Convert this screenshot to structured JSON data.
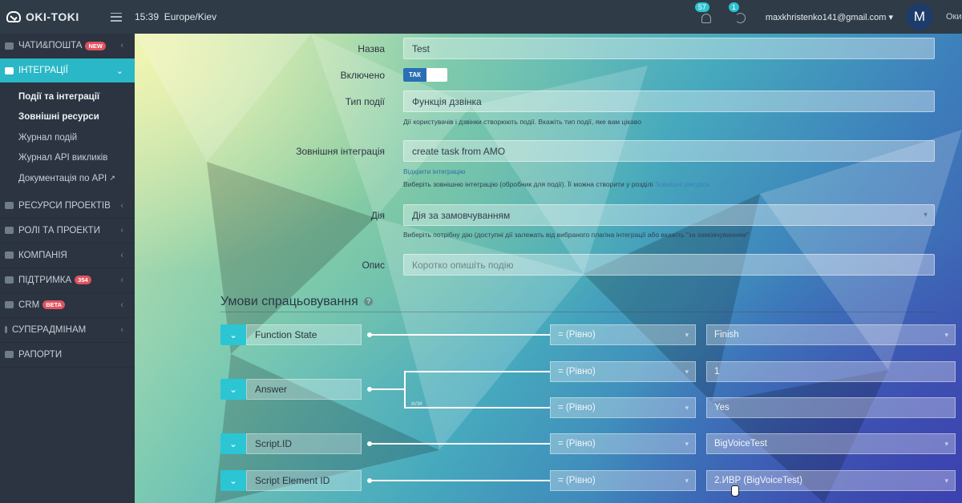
{
  "topbar": {
    "logo_text": "OKI-TOKI",
    "time": "15:39",
    "timezone": "Europe/Kiev",
    "notifications_count": "57",
    "sync_count": "1",
    "email": "maxkhristenko141@gmail.com",
    "avatar_letter": "M",
    "user_trunc": "Оки-"
  },
  "sidebar": {
    "items": [
      {
        "label": "ЧАТИ&ПОШТА",
        "badge": "NEW"
      },
      {
        "label": "ІНТЕГРАЦІЇ"
      },
      {
        "label": "РЕСУРСИ ПРОЕКТІВ"
      },
      {
        "label": "РОЛІ ТА ПРОЕКТИ"
      },
      {
        "label": "КОМПАНІЯ"
      },
      {
        "label": "ПІДТРИМКА",
        "badge": "354"
      },
      {
        "label": "CRM",
        "badge": "BETA"
      },
      {
        "label": "СУПЕРАДМІНАМ"
      },
      {
        "label": "РАПОРТИ"
      }
    ],
    "subitems": [
      "Події та інтеграції",
      "Зовнішні ресурси",
      "Журнал подій",
      "Журнал API викликів",
      "Документація по API"
    ]
  },
  "form": {
    "name_label": "Назва",
    "name_value": "Test",
    "enabled_label": "Включено",
    "enabled_value": "ТАК",
    "event_type_label": "Тип події",
    "event_type_value": "Функція дзвінка",
    "event_type_help": "Дії користувачів і дзвінки створюють події. Вкажіть тип події, яке вам цікаво",
    "ext_integration_label": "Зовнішня інтеграція",
    "ext_integration_value": "create task from AMO",
    "ext_integration_link": "Відкрити інтеграцію",
    "ext_integration_help": "Виберіть зовнішню інтеграцію (обробник для події). Її можна створити у розділі",
    "ext_integration_help_link": "Зовнішні ресурси",
    "action_label": "Дія",
    "action_value": "Дія за замовчуванням",
    "action_help": "Виберіть потрібну дію (доступні дії залежать від вибраного плагіна інтеграції або вкажіть \"за замовчуванням\"",
    "desc_label": "Опис",
    "desc_placeholder": "Коротко опишіть подію"
  },
  "conditions": {
    "title": "Умови спрацьовування",
    "help_icon": "?",
    "or_label": "или",
    "rows": [
      {
        "field": "Function State",
        "ops": [
          {
            "op": "= (Рівно)",
            "value": "Finish"
          }
        ]
      },
      {
        "field": "Answer",
        "ops": [
          {
            "op": "= (Рівно)",
            "value": "1"
          },
          {
            "op": "= (Рівно)",
            "value": "Yes"
          }
        ]
      },
      {
        "field": "Script.ID",
        "ops": [
          {
            "op": "= (Рівно)",
            "value": "BigVoiceTest"
          }
        ]
      },
      {
        "field": "Script Element ID",
        "ops": [
          {
            "op": "= (Рівно)",
            "value": "2.ИВР (BigVoiceTest)"
          }
        ]
      }
    ]
  },
  "colors": {
    "accent": "#2ab7c7",
    "copy_button": "#23b455",
    "delete_button": "#e0525f",
    "sidebar_bg": "#2b3440",
    "topbar_bg": "#2f3b47"
  },
  "icons": {
    "logo": "cloud-check-icon",
    "menu": "hamburger-icon",
    "notifications": "bell-icon",
    "sync": "sync-icon",
    "copy": "copy-icon",
    "delete": "trash-icon",
    "expand": "chevron-down-icon",
    "external": "external-link-icon"
  }
}
